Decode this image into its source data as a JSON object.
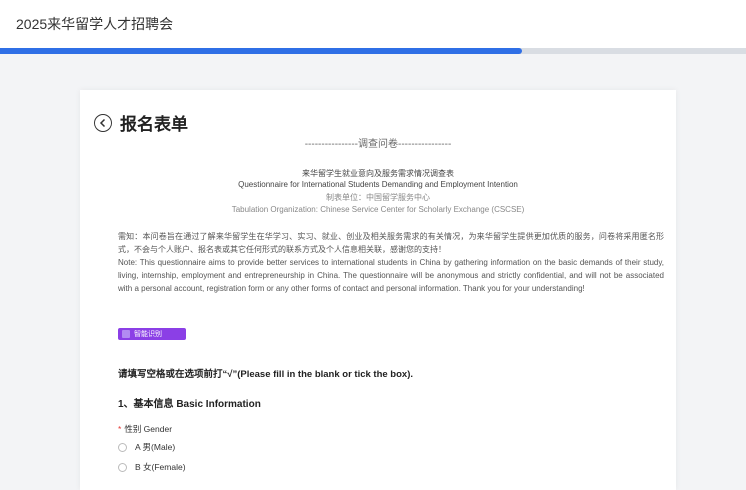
{
  "app": {
    "title": "2025来华留学人才招聘会"
  },
  "progress": {
    "fraction": 0.7
  },
  "form": {
    "title": "报名表单",
    "questionnaire_heading": "----------------调查问卷----------------",
    "title_cn": "来华留学生就业意向及服务需求情况调查表",
    "title_en": "Questionnaire for International Students Demanding and Employment Intention",
    "org_cn": "制表单位：中国留学服务中心",
    "org_en": "Tabulation Organization: Chinese Service Center for Scholarly Exchange (CSCSE)",
    "notice_cn": "需知：本问卷旨在通过了解来华留学生在华学习、实习、就业、创业及相关服务需求的有关情况，为来华留学生提供更加优质的服务，问卷将采用匿名形式，不会与个人账户、报名表或其它任何形式的联系方式及个人信息相关联，感谢您的支持！",
    "notice_en": "Note: This questionnaire aims to provide better services to international students in China by gathering information on the basic demands of their study, living, internship, employment and entrepreneurship in China. The questionnaire will be anonymous and strictly confidential, and will not be associated with a personal account, registration form or any other forms of contact and personal information. Thank you for your understanding!",
    "tag_label": "智能识别",
    "instruction": "请填写空格或在选项前打“√”(Please fill in the blank or tick the box).",
    "section_title": "1、基本信息 Basic Information",
    "gender_label": "性别 Gender",
    "gender_required_mark": "*",
    "options": [
      "A 男(Male)",
      "B 女(Female)"
    ]
  },
  "colors": {
    "progress": "#2f6fe6",
    "tag": "#8b3fe6",
    "required": "#e53935"
  }
}
